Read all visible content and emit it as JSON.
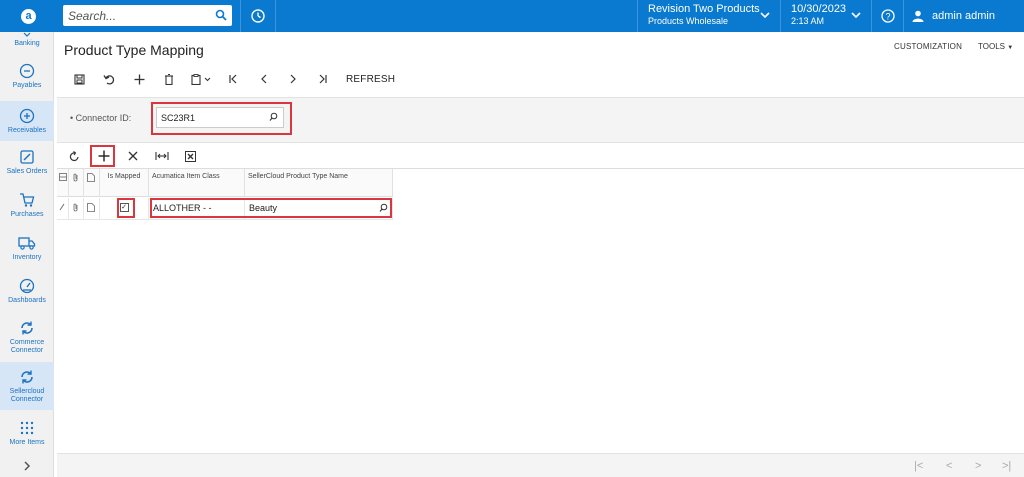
{
  "topbar": {
    "search_placeholder": "Search...",
    "tenant_name": "Revision Two Products",
    "tenant_sub": "Products Wholesale",
    "date": "10/30/2023",
    "time": "2:13 AM",
    "user": "admin admin",
    "brand_color": "#0a7ad0"
  },
  "sidebar": {
    "items": [
      {
        "label": "Banking",
        "icon": "banking-icon"
      },
      {
        "label": "Payables",
        "icon": "minus-circle-icon"
      },
      {
        "label": "Receivables",
        "icon": "plus-circle-icon"
      },
      {
        "label": "Sales Orders",
        "icon": "pencil-icon"
      },
      {
        "label": "Purchases",
        "icon": "cart-icon"
      },
      {
        "label": "Inventory",
        "icon": "truck-icon"
      },
      {
        "label": "Dashboards",
        "icon": "gauge-icon"
      },
      {
        "label": "Commerce Connector",
        "icon": "sync-icon"
      },
      {
        "label": "Sellercloud Connector",
        "icon": "sync-icon"
      },
      {
        "label": "More Items",
        "icon": "grid-icon"
      }
    ]
  },
  "page": {
    "title": "Product Type Mapping",
    "customization": "CUSTOMIZATION",
    "tools": "TOOLS"
  },
  "toolbar": {
    "refresh_label": "REFRESH"
  },
  "form": {
    "connector_label": "Connector ID:",
    "connector_value": "SC23R1"
  },
  "grid": {
    "headers": {
      "is_mapped": "Is Mapped",
      "class": "Acumatica Item Class",
      "type_name": "SellerCloud Product Type Name"
    },
    "rows": [
      {
        "is_mapped": true,
        "class": "ALLOTHER - -",
        "type_name": "Beauty"
      }
    ]
  }
}
